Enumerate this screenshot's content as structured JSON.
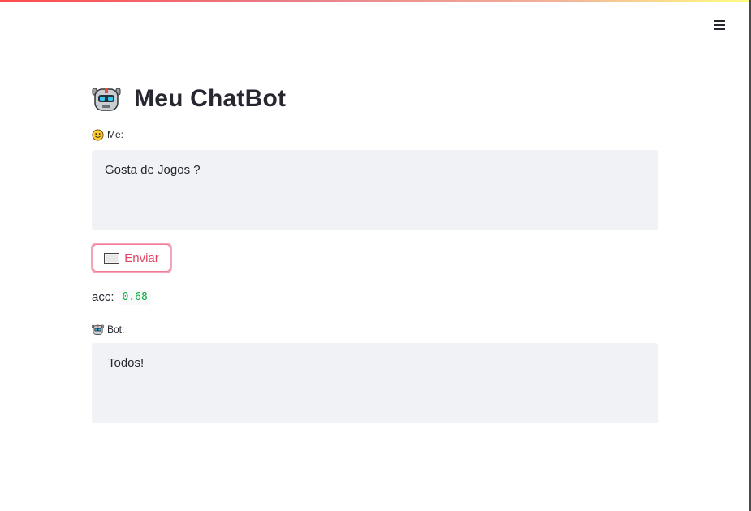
{
  "header": {
    "menu_icon": "hamburger-menu-icon",
    "gradient_colors": [
      "#ff4b4b",
      "#fffd80"
    ]
  },
  "main": {
    "title": "Meu ChatBot",
    "title_icon": "robot-icon",
    "me_label": "Me:",
    "me_icon": "smiley-face-icon",
    "me_text": "Gosta de Jogos ?",
    "send_button_label": "Enviar",
    "send_button_icon": "envelope-icon",
    "acc_label": "acc:",
    "acc_value": "0.68",
    "bot_label": "Bot:",
    "bot_icon": "robot-icon",
    "bot_text": "Todos!"
  },
  "colors": {
    "accent": "#ff4b4b",
    "text_area_bg": "#f0f2f6",
    "acc_value": "#09ab3b"
  }
}
